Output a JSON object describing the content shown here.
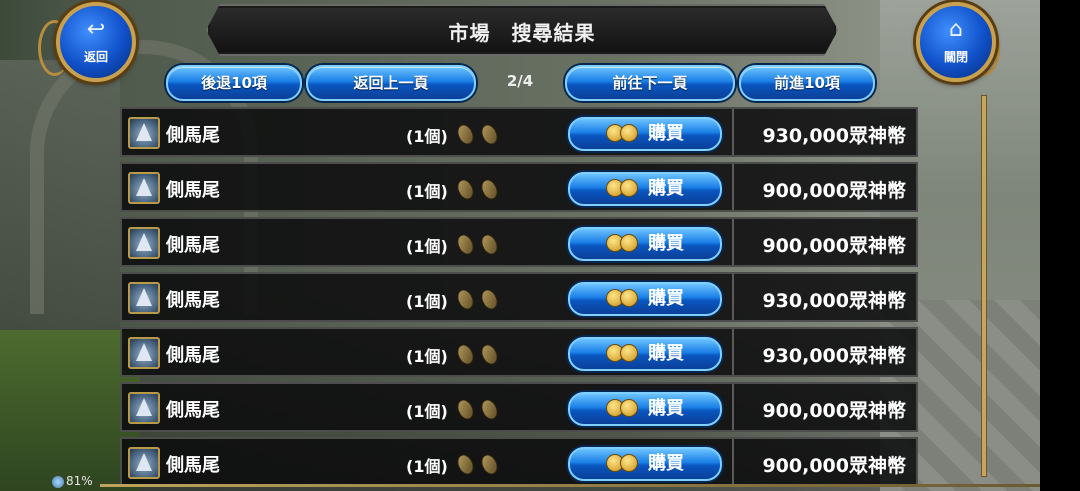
{
  "header": {
    "title": "市場　搜尋結果",
    "back_label": "返回",
    "close_label": "關閉"
  },
  "nav": {
    "back10": "後退10項",
    "prev_page": "返回上一頁",
    "page_indicator": "2/4",
    "next_page": "前往下一頁",
    "forward10": "前進10項"
  },
  "listings": [
    {
      "name": "側馬尾",
      "qty": "(1個)",
      "buy": "購買",
      "price": "930,000眾神幣"
    },
    {
      "name": "側馬尾",
      "qty": "(1個)",
      "buy": "購買",
      "price": "900,000眾神幣"
    },
    {
      "name": "側馬尾",
      "qty": "(1個)",
      "buy": "購買",
      "price": "900,000眾神幣"
    },
    {
      "name": "側馬尾",
      "qty": "(1個)",
      "buy": "購買",
      "price": "930,000眾神幣"
    },
    {
      "name": "側馬尾",
      "qty": "(1個)",
      "buy": "購買",
      "price": "930,000眾神幣"
    },
    {
      "name": "側馬尾",
      "qty": "(1個)",
      "buy": "購買",
      "price": "900,000眾神幣"
    },
    {
      "name": "側馬尾",
      "qty": "(1個)",
      "buy": "購買",
      "price": "900,000眾神幣"
    }
  ],
  "status": {
    "battery": "81%"
  },
  "colors": {
    "button_blue": "#1a7fe6",
    "ornament_gold": "#c8a14f",
    "panel_dark": "#0a0a0c"
  },
  "icons": {
    "back": "back-arrow-icon",
    "close": "home-icon",
    "item": "wizard-hat-icon",
    "seed": "seed-icon",
    "coin": "coin-icon"
  }
}
